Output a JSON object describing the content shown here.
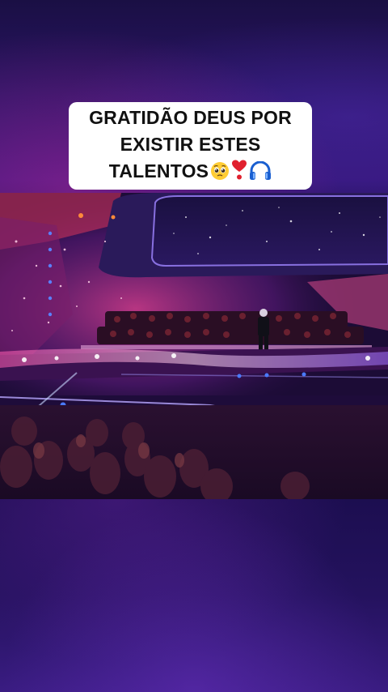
{
  "caption": {
    "line1": "GRATIDÃO DEUS POR",
    "line2": "EXISTIR ESTES",
    "line3": "TALENTOS",
    "emojis": [
      "pleading-face-icon",
      "heart-exclamation-icon",
      "headphones-icon"
    ]
  },
  "scene": {
    "description_icon": "concert-stage-image"
  }
}
